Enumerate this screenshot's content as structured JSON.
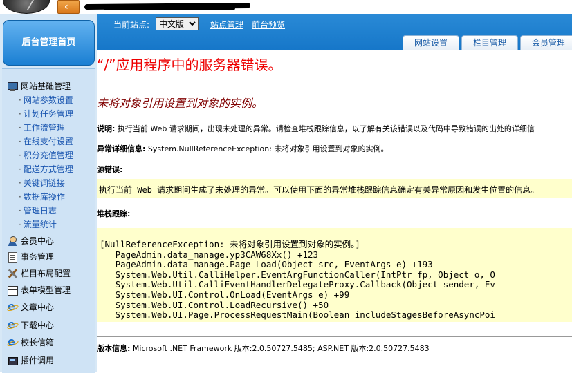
{
  "sidebar": {
    "home_label": "后台管理首页",
    "groups": [
      {
        "label": "网站基础管理",
        "icon": "monitor-icon"
      },
      {
        "label": "会员中心",
        "icon": "user-icon"
      },
      {
        "label": "事务管理",
        "icon": "document-icon"
      },
      {
        "label": "栏目布局配置",
        "icon": "tools-icon"
      },
      {
        "label": "表单模型管理",
        "icon": "table-icon"
      },
      {
        "label": "文章中心",
        "icon": "ie-icon"
      },
      {
        "label": "下载中心",
        "icon": "ie-icon"
      },
      {
        "label": "校长信箱",
        "icon": "ie-icon"
      },
      {
        "label": "插件调用",
        "icon": "plugin-icon"
      }
    ],
    "sub_items": [
      "网站参数设置",
      "计划任务管理",
      "工作流管理",
      "在线支付设置",
      "积分充值管理",
      "配送方式管理",
      "关键词链接",
      "数据库操作",
      "管理日志",
      "流量统计"
    ],
    "dot": "·"
  },
  "navbar": {
    "site_label": "当前站点:",
    "site_select": "中文版",
    "links": [
      "站点管理",
      "前台预览"
    ],
    "tabs": [
      "网站设置",
      "栏目管理",
      "会员管理"
    ]
  },
  "content": {
    "title": "“/”应用程序中的服务器错误。",
    "subtitle": "未将对象引用设置到对象的实例。",
    "description_label": "说明:",
    "description_text": " 执行当前 Web 请求期间，出现未处理的异常。请检查堆栈跟踪信息，以了解有关该错误以及代码中导致错误的出处的详细信",
    "exception_label": "异常详细信息:",
    "exception_text": " System.NullReferenceException: 未将对象引用设置到对象的实例。",
    "source_label": "源错误:",
    "source_text": "执行当前 Web 请求期间生成了未处理的异常。可以使用下面的异常堆栈跟踪信息确定有关异常原因和发生位置的信息。",
    "stack_label": "堆栈跟踪:",
    "stack_lines": [
      "[NullReferenceException: 未将对象引用设置到对象的实例。]",
      "   PageAdmin.data_manage.yp3CAW68Xx() +123",
      "   PageAdmin.data_manage.Page_Load(Object src, EventArgs e) +193",
      "   System.Web.Util.CalliHelper.EventArgFunctionCaller(IntPtr fp, Object o, O",
      "   System.Web.Util.CalliEventHandlerDelegateProxy.Callback(Object sender, Ev",
      "   System.Web.UI.Control.OnLoad(EventArgs e) +99",
      "   System.Web.UI.Control.LoadRecursive() +50",
      "   System.Web.UI.Page.ProcessRequestMain(Boolean includeStagesBeforeAsyncPoi"
    ],
    "version_label": "版本信息:",
    "version_text": " Microsoft .NET Framework 版本:2.0.50727.5485; ASP.NET 版本:2.0.50727.5483"
  },
  "topbar": {
    "back_glyph": "‹"
  },
  "colors": {
    "nav_blue": "#1677c9",
    "error_red": "#e00000",
    "subtitle_maroon": "#800000",
    "code_bg": "#ffffcc",
    "sidebar_bg": "#d7e8f6"
  }
}
